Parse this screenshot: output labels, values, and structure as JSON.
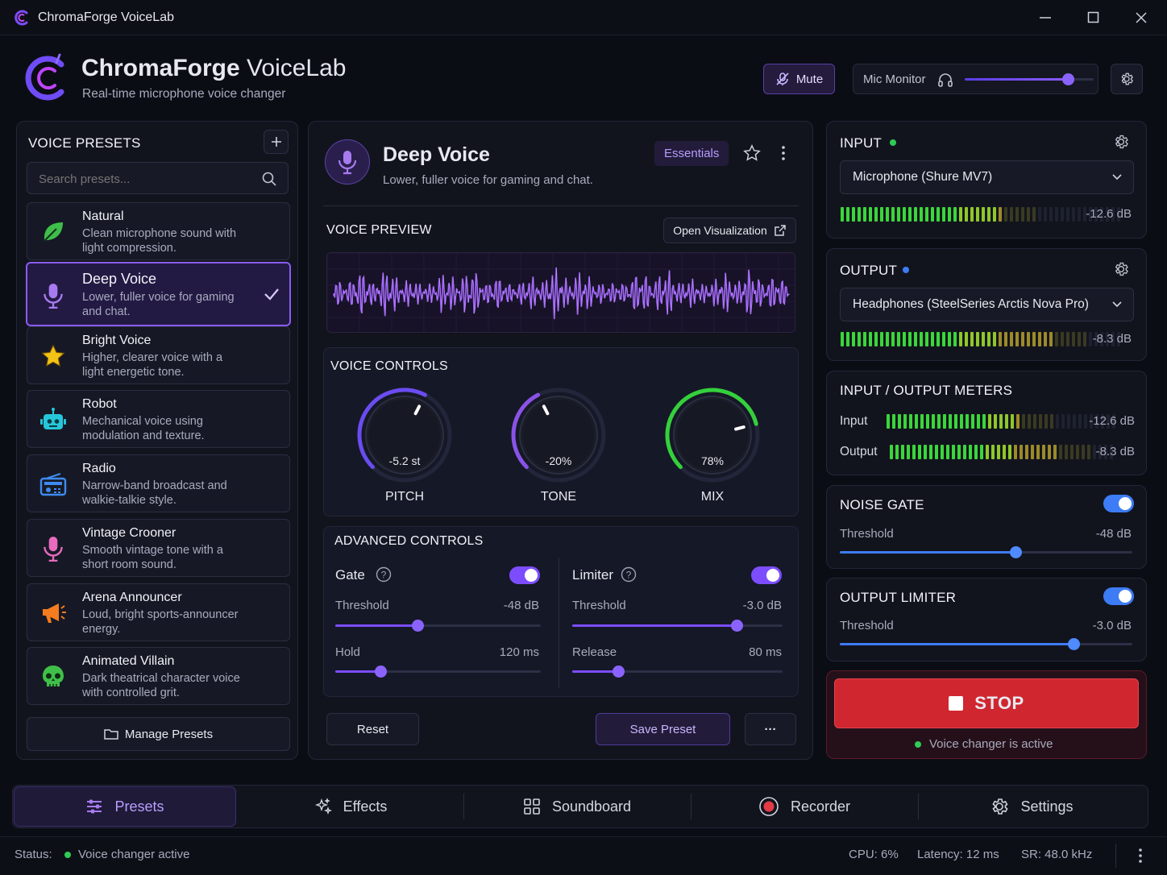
{
  "window": {
    "title": "ChromaForge VoiceLab"
  },
  "header": {
    "brand_bold": "ChromaForge",
    "brand_light": "VoiceLab",
    "subtitle": "Real-time microphone voice changer",
    "mute_label": "Mute",
    "mic_monitor_label": "Mic Monitor",
    "mic_monitor_level": 0.8
  },
  "presets": {
    "title": "VOICE PRESETS",
    "search_placeholder": "Search presets...",
    "manage_label": "Manage Presets",
    "items": [
      {
        "name": "Natural",
        "desc": "Clean microphone sound with light compression.",
        "icon": "leaf-icon",
        "color": "#3fbf4a"
      },
      {
        "name": "Deep Voice",
        "desc": "Lower, fuller voice for gaming and chat.",
        "icon": "microphone-icon",
        "color": "#a77bf0",
        "selected": true
      },
      {
        "name": "Bright Voice",
        "desc": "Higher, clearer voice with a light energetic tone.",
        "icon": "star-icon",
        "color": "#f3c316"
      },
      {
        "name": "Robot",
        "desc": "Mechanical voice using modulation and texture.",
        "icon": "robot-icon",
        "color": "#26c6da"
      },
      {
        "name": "Radio",
        "desc": "Narrow-band broadcast and walkie-talkie style.",
        "icon": "radio-icon",
        "color": "#3d8bf0"
      },
      {
        "name": "Vintage Crooner",
        "desc": "Smooth vintage tone with a short room sound.",
        "icon": "microphone-icon",
        "color": "#e86bbd"
      },
      {
        "name": "Arena Announcer",
        "desc": "Loud, bright sports-announcer energy.",
        "icon": "megaphone-icon",
        "color": "#f57c1f"
      },
      {
        "name": "Animated Villain",
        "desc": "Dark theatrical character voice with controlled grit.",
        "icon": "skull-icon",
        "color": "#3fbf4a"
      }
    ]
  },
  "center": {
    "preset_name": "Deep Voice",
    "preset_desc": "Lower, fuller voice for gaming and chat.",
    "tag": "Essentials",
    "preview_title": "VOICE PREVIEW",
    "open_vis_label": "Open Visualization",
    "controls_title": "VOICE CONTROLS",
    "knobs": [
      {
        "label": "PITCH",
        "value": "-5.2 st",
        "level": 0.6,
        "color": "#6a4cf0"
      },
      {
        "label": "TONE",
        "value": "-20%",
        "level": 0.4,
        "color": "#8a52e8"
      },
      {
        "label": "MIX",
        "value": "78%",
        "level": 0.78,
        "color": "#34d03c"
      }
    ],
    "advanced_title": "ADVANCED CONTROLS",
    "gate": {
      "label": "Gate",
      "threshold_label": "Threshold",
      "threshold_value": "-48 dB",
      "threshold_level": 0.4,
      "hold_label": "Hold",
      "hold_value": "120 ms",
      "hold_level": 0.22
    },
    "limiter": {
      "label": "Limiter",
      "threshold_label": "Threshold",
      "threshold_value": "-3.0 dB",
      "threshold_level": 0.78,
      "release_label": "Release",
      "release_value": "80 ms",
      "release_level": 0.22
    },
    "reset_label": "Reset",
    "save_label": "Save Preset",
    "more_label": "···"
  },
  "input": {
    "title": "INPUT",
    "device": "Microphone (Shure MV7)",
    "db": "-12.6 dB",
    "level": 0.58
  },
  "output": {
    "title": "OUTPUT",
    "device": "Headphones (SteelSeries Arctis Nova Pro)",
    "db": "-8.3 dB",
    "level": 0.76
  },
  "meters": {
    "title": "INPUT / OUTPUT METERS",
    "input_label": "Input",
    "input_db": "-12.6 dB",
    "output_label": "Output",
    "output_db": "-8.3 dB"
  },
  "noise_gate": {
    "title": "NOISE GATE",
    "threshold_label": "Threshold",
    "threshold_value": "-48 dB",
    "level": 0.6
  },
  "limiter": {
    "title": "OUTPUT LIMITER",
    "threshold_label": "Threshold",
    "threshold_value": "-3.0 dB",
    "level": 0.8
  },
  "stop": {
    "label": "STOP",
    "status": "Voice changer is active"
  },
  "nav": [
    {
      "label": "Presets",
      "icon": "sliders-icon"
    },
    {
      "label": "Effects",
      "icon": "sparkles-icon"
    },
    {
      "label": "Soundboard",
      "icon": "grid-icon"
    },
    {
      "label": "Recorder",
      "icon": "record-icon"
    },
    {
      "label": "Settings",
      "icon": "gear-icon"
    }
  ],
  "statusbar": {
    "status_label": "Status:",
    "status_value": "Voice changer active",
    "cpu": "CPU: 6%",
    "latency": "Latency: 12 ms",
    "sr": "SR: 48.0 kHz"
  }
}
